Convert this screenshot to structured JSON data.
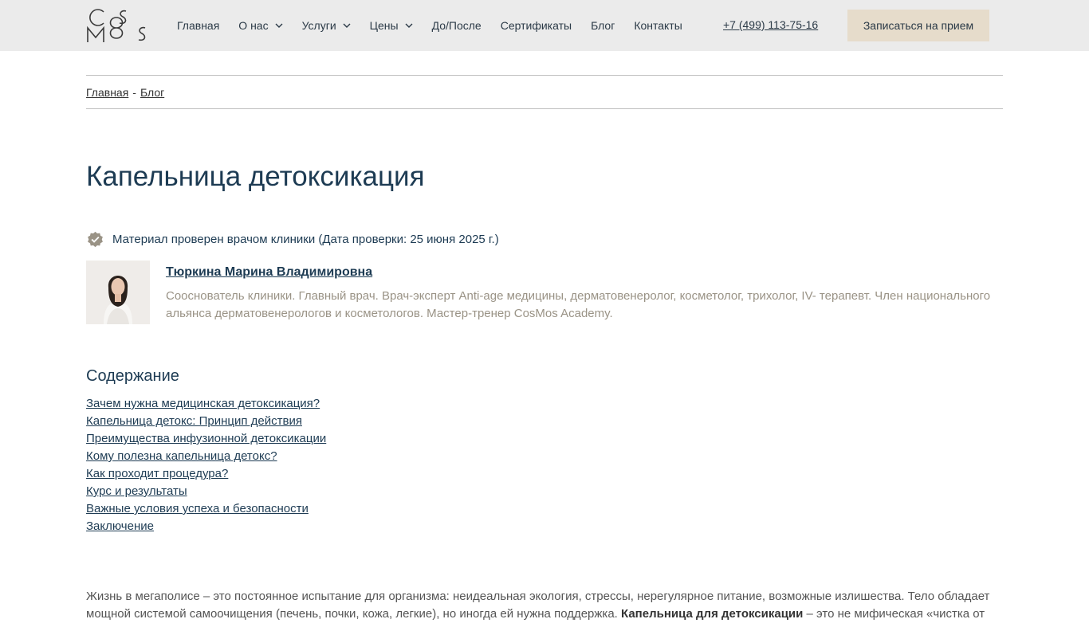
{
  "header": {
    "nav": [
      {
        "label": "Главная",
        "has_dropdown": false
      },
      {
        "label": "О нас",
        "has_dropdown": true
      },
      {
        "label": "Услуги",
        "has_dropdown": true
      },
      {
        "label": "Цены",
        "has_dropdown": true
      },
      {
        "label": "До/После",
        "has_dropdown": false
      },
      {
        "label": "Сертификаты",
        "has_dropdown": false
      },
      {
        "label": "Блог",
        "has_dropdown": false
      },
      {
        "label": "Контакты",
        "has_dropdown": false
      }
    ],
    "phone": "+7 (499) 113-75-16",
    "cta_label": "Записаться на прием"
  },
  "breadcrumb": {
    "home": "Главная",
    "separator": "-",
    "current": "Блог"
  },
  "article": {
    "title": "Капельница детоксикация",
    "verified_text": "Материал проверен врачом клиники (Дата проверки: 25 июня 2025 г.)",
    "author": {
      "name": "Тюркина Марина Владимировна",
      "description": "Сооснователь клиники. Главный врач. Врач-эксперт Anti-age медицины, дерматовенеролог, косметолог, трихолог, IV- терапевт. Член национального альянса дерматовенерологов и косметологов. Мастер-тренер CosMos Academy."
    },
    "toc_title": "Содержание",
    "toc": [
      "Зачем нужна медицинская детоксикация?",
      "Капельница детокс: Принцип действия",
      "Преимущества инфузионной детоксикации",
      "Кому полезна капельница детокс?",
      "Как проходит процедура?",
      "Курс и результаты",
      "Важные условия успеха и безопасности",
      "Заключение"
    ],
    "intro_line1": "Жизнь в мегаполисе – это постоянное испытание для организма: неидеальная экология, стрессы, нерегулярное питание, возможные излишества. Тело обладает",
    "intro_line2_start": "мощной системой самоочищения (печень, почки, кожа, легкие), но иногда ей нужна поддержка.",
    "intro_bold": "Капельница для детоксикации",
    "intro_line2_end": "– это не мифическая «чистка от"
  },
  "colors": {
    "header_bg": "#ebebeb",
    "cta_bg": "#e6dccb",
    "heading": "#1d3b53",
    "muted": "#9a9386",
    "badge": "#9a9386"
  },
  "icons": {
    "logo": "cosmos-logo",
    "dropdown": "chevron-down-icon",
    "verified": "verified-badge-icon",
    "avatar": "author-photo"
  }
}
